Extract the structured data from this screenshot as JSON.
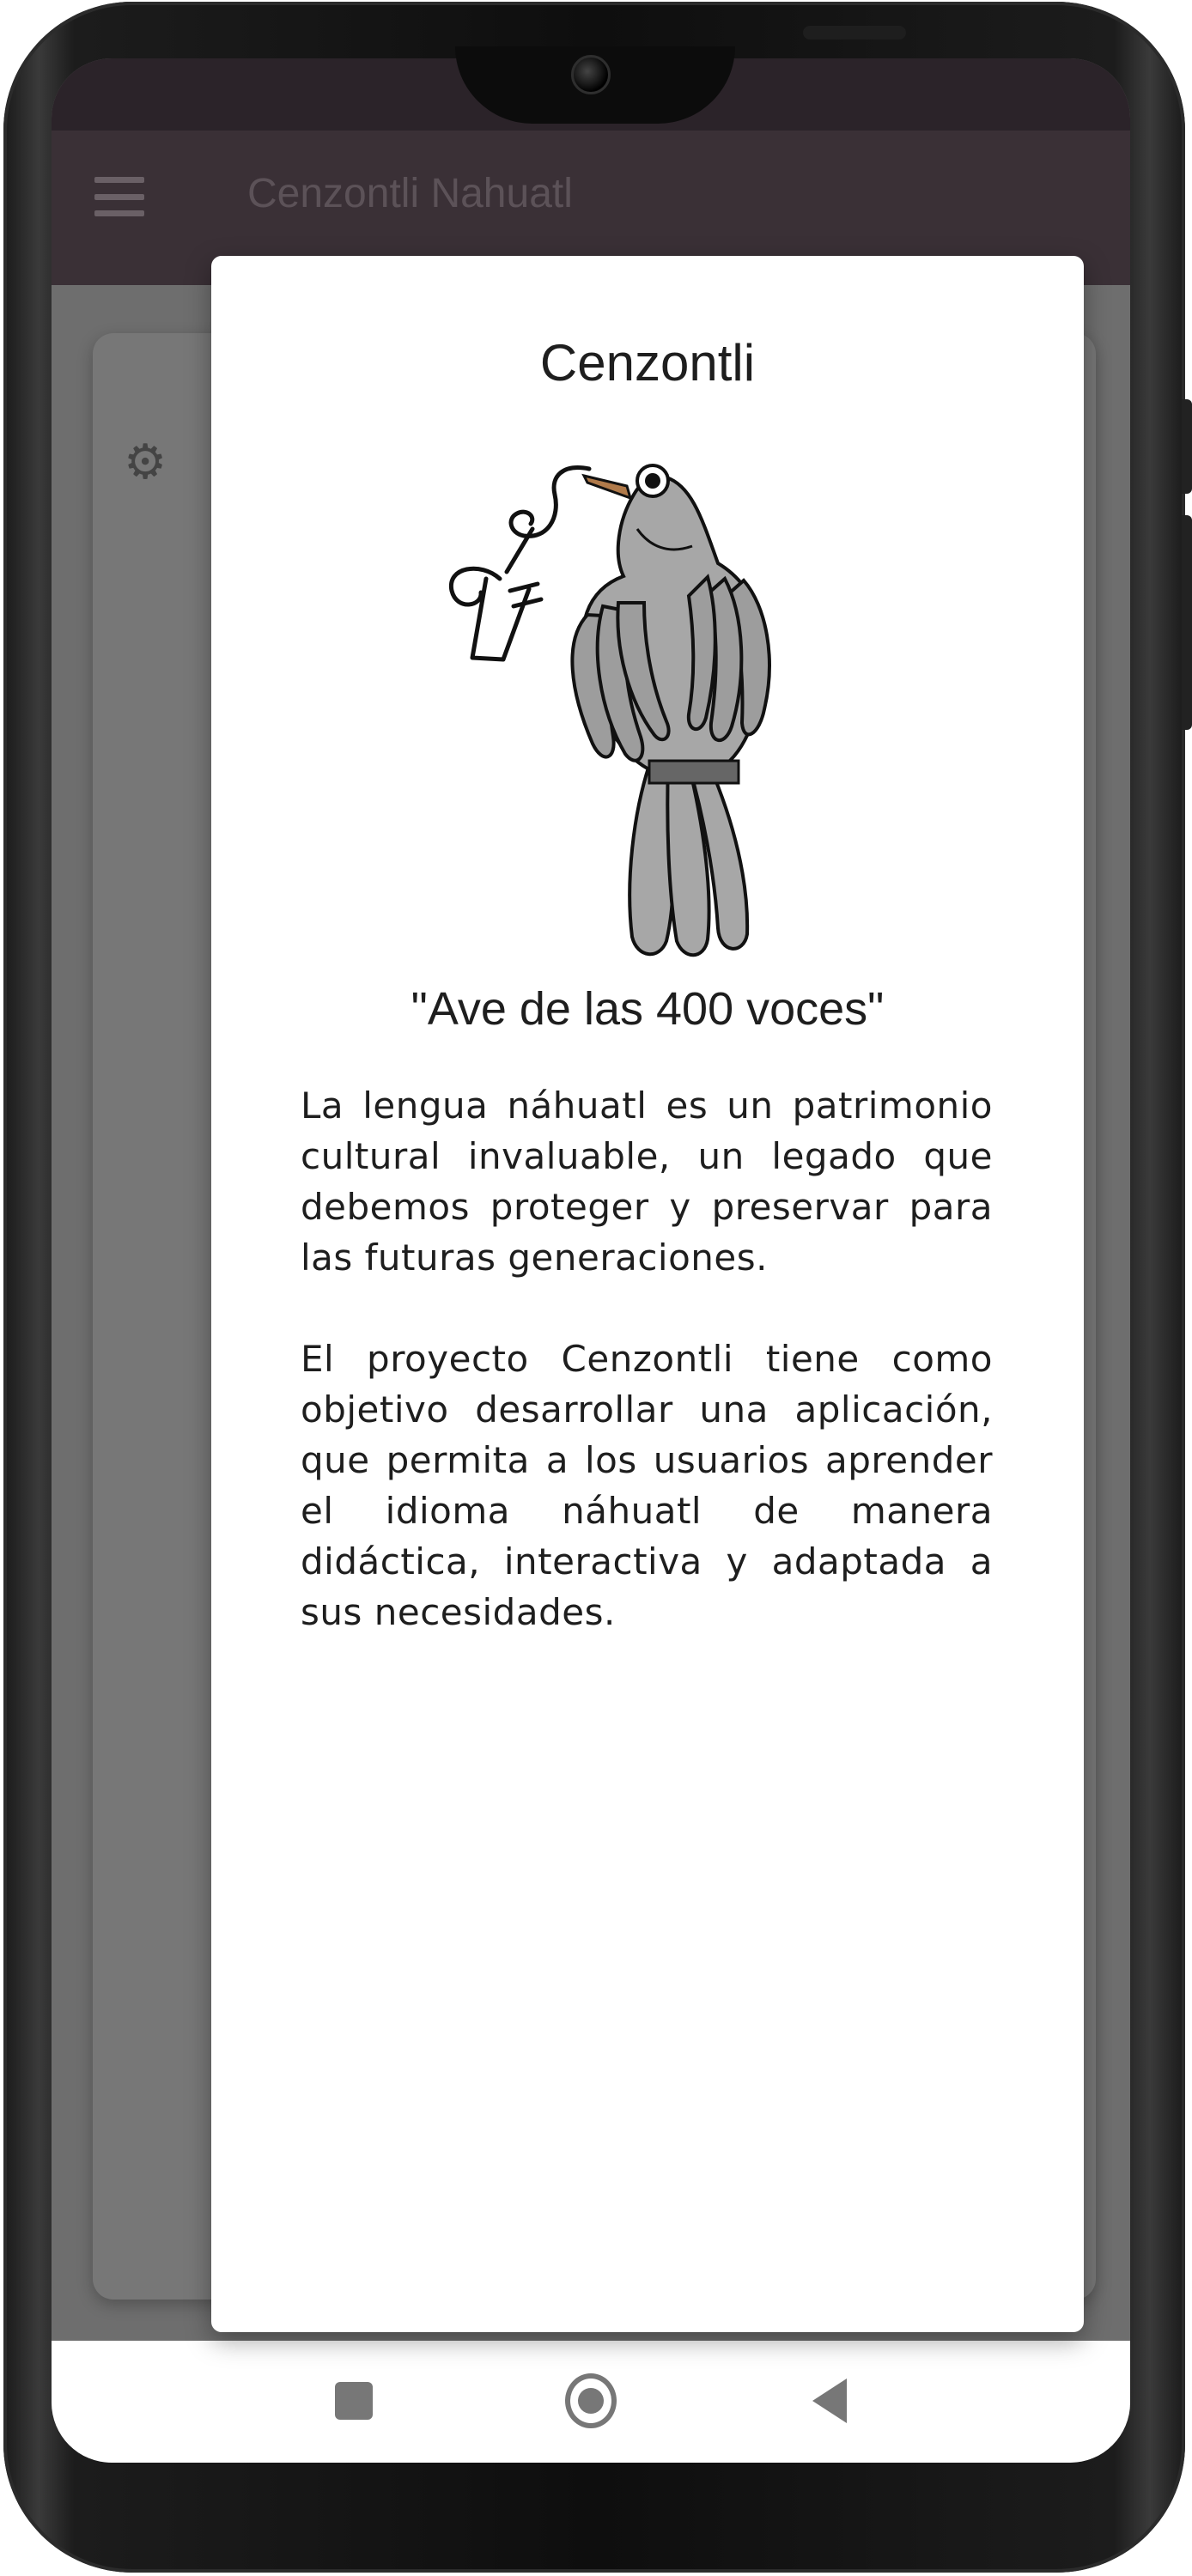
{
  "app_bar": {
    "title": "Cenzontli Nahuatl",
    "menu_icon": "hamburger-menu-icon"
  },
  "dialog": {
    "title": "Cenzontli",
    "image_icon": "cenzontli-bird-illustration",
    "subtitle": "\"Ave de las 400 voces\"",
    "paragraphs": [
      "La lengua náhuatl es un patrimonio cultural invaluable, un legado que debemos proteger y preservar para las futuras generaciones.",
      "El proyecto Cenzontli tiene como objetivo desarrollar una aplicación, que permita a los usuarios aprender el idioma náhuatl de manera didáctica, interactiva y adaptada a sus necesidades."
    ]
  },
  "nav_bar": {
    "recents_icon": "square-recents-icon",
    "home_icon": "circle-home-icon",
    "back_icon": "triangle-back-icon"
  },
  "colors": {
    "app_bar": "#3a3036",
    "scrim": "#6e6e6e",
    "dialog_bg": "#ffffff",
    "bird_gray": "#a7a7a7",
    "beak": "#b07a4a"
  }
}
